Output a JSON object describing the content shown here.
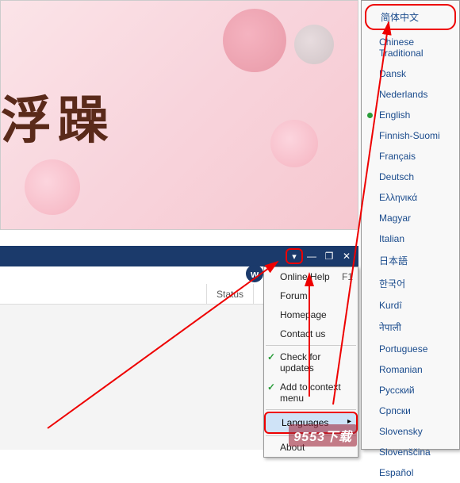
{
  "banner": {
    "text": "浮躁"
  },
  "titlebar": {
    "dropdown_icon": "▾",
    "min_icon": "—",
    "restore_icon": "❐",
    "close_icon": "✕",
    "w_badge": "w"
  },
  "subbar": {
    "status_header": "Status"
  },
  "context_menu": {
    "online_help": "Online Help",
    "online_help_shortcut": "F1",
    "forum": "Forum",
    "homepage": "Homepage",
    "contact": "Contact us",
    "check_updates": "Check for updates",
    "add_context": "Add to context menu",
    "languages": "Languages",
    "languages_arrow": "▸",
    "about": "About"
  },
  "languages": {
    "items": [
      {
        "label": "简体中文",
        "circled": true,
        "selected": false
      },
      {
        "label": "Chinese Traditional",
        "circled": false,
        "selected": false
      },
      {
        "label": "Dansk",
        "circled": false,
        "selected": false
      },
      {
        "label": "Nederlands",
        "circled": false,
        "selected": false
      },
      {
        "label": "English",
        "circled": false,
        "selected": true
      },
      {
        "label": "Finnish-Suomi",
        "circled": false,
        "selected": false
      },
      {
        "label": "Français",
        "circled": false,
        "selected": false
      },
      {
        "label": "Deutsch",
        "circled": false,
        "selected": false
      },
      {
        "label": "Ελληνικά",
        "circled": false,
        "selected": false
      },
      {
        "label": "Magyar",
        "circled": false,
        "selected": false
      },
      {
        "label": "Italian",
        "circled": false,
        "selected": false
      },
      {
        "label": "日本語",
        "circled": false,
        "selected": false
      },
      {
        "label": "한국어",
        "circled": false,
        "selected": false
      },
      {
        "label": "Kurdî",
        "circled": false,
        "selected": false
      },
      {
        "label": "नेपाली",
        "circled": false,
        "selected": false
      },
      {
        "label": "Portuguese",
        "circled": false,
        "selected": false
      },
      {
        "label": "Romanian",
        "circled": false,
        "selected": false
      },
      {
        "label": "Русский",
        "circled": false,
        "selected": false
      },
      {
        "label": "Српски",
        "circled": false,
        "selected": false
      },
      {
        "label": "Slovensky",
        "circled": false,
        "selected": false
      },
      {
        "label": "Slovenščina",
        "circled": false,
        "selected": false
      },
      {
        "label": "Español",
        "circled": false,
        "selected": false
      }
    ]
  },
  "watermark": "9553下载"
}
